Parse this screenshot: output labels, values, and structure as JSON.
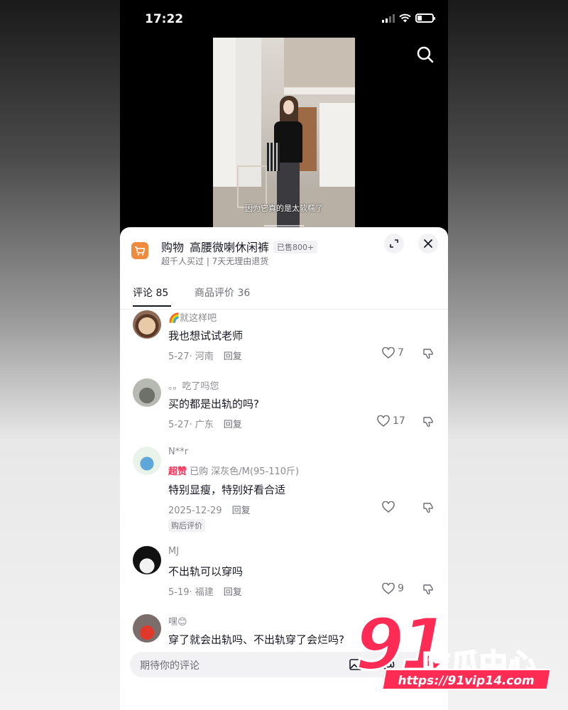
{
  "status_bar": {
    "time": "17:22"
  },
  "video": {
    "caption": "因为它真的是太软糯了"
  },
  "product": {
    "tag": "购物",
    "title": "高腰微喇休闲裤",
    "sold": "已售800+",
    "subtitle": "超千人买过 | 7天无理由退货"
  },
  "tabs": [
    {
      "label": "评论 85"
    },
    {
      "label": "商品评价 36"
    }
  ],
  "comments": [
    {
      "user": "🌈就这样吧",
      "text": "我也想试试老师",
      "meta": "5-27· 河南",
      "reply": "回复",
      "likes": "7"
    },
    {
      "user": "。。吃了吗您",
      "text": "买的都是出轨的吗?",
      "meta": "5-27· 广东",
      "reply": "回复",
      "likes": "17"
    },
    {
      "user": "N**r",
      "badge": "超赞",
      "purchase": "已购  深灰色/M(95-110斤)",
      "text": "特别显瘦，特别好看合适",
      "meta": "2025-12-29",
      "reply": "回复",
      "likes": "",
      "tag": "购后评价"
    },
    {
      "user": "MJ",
      "text": "不出轨可以穿吗",
      "meta": "5-19· 福建",
      "reply": "回复",
      "likes": "9"
    },
    {
      "user": "嘿😊",
      "text": "穿了就会出轨吗、不出轨穿了会烂吗?"
    }
  ],
  "input": {
    "placeholder": "期待你的评论"
  },
  "watermark": {
    "number": "91",
    "brand": "吃瓜中心",
    "url": "https://91vip14.com"
  },
  "colors": {
    "accent": "#fe2c55",
    "shop": "#f08a3c"
  }
}
